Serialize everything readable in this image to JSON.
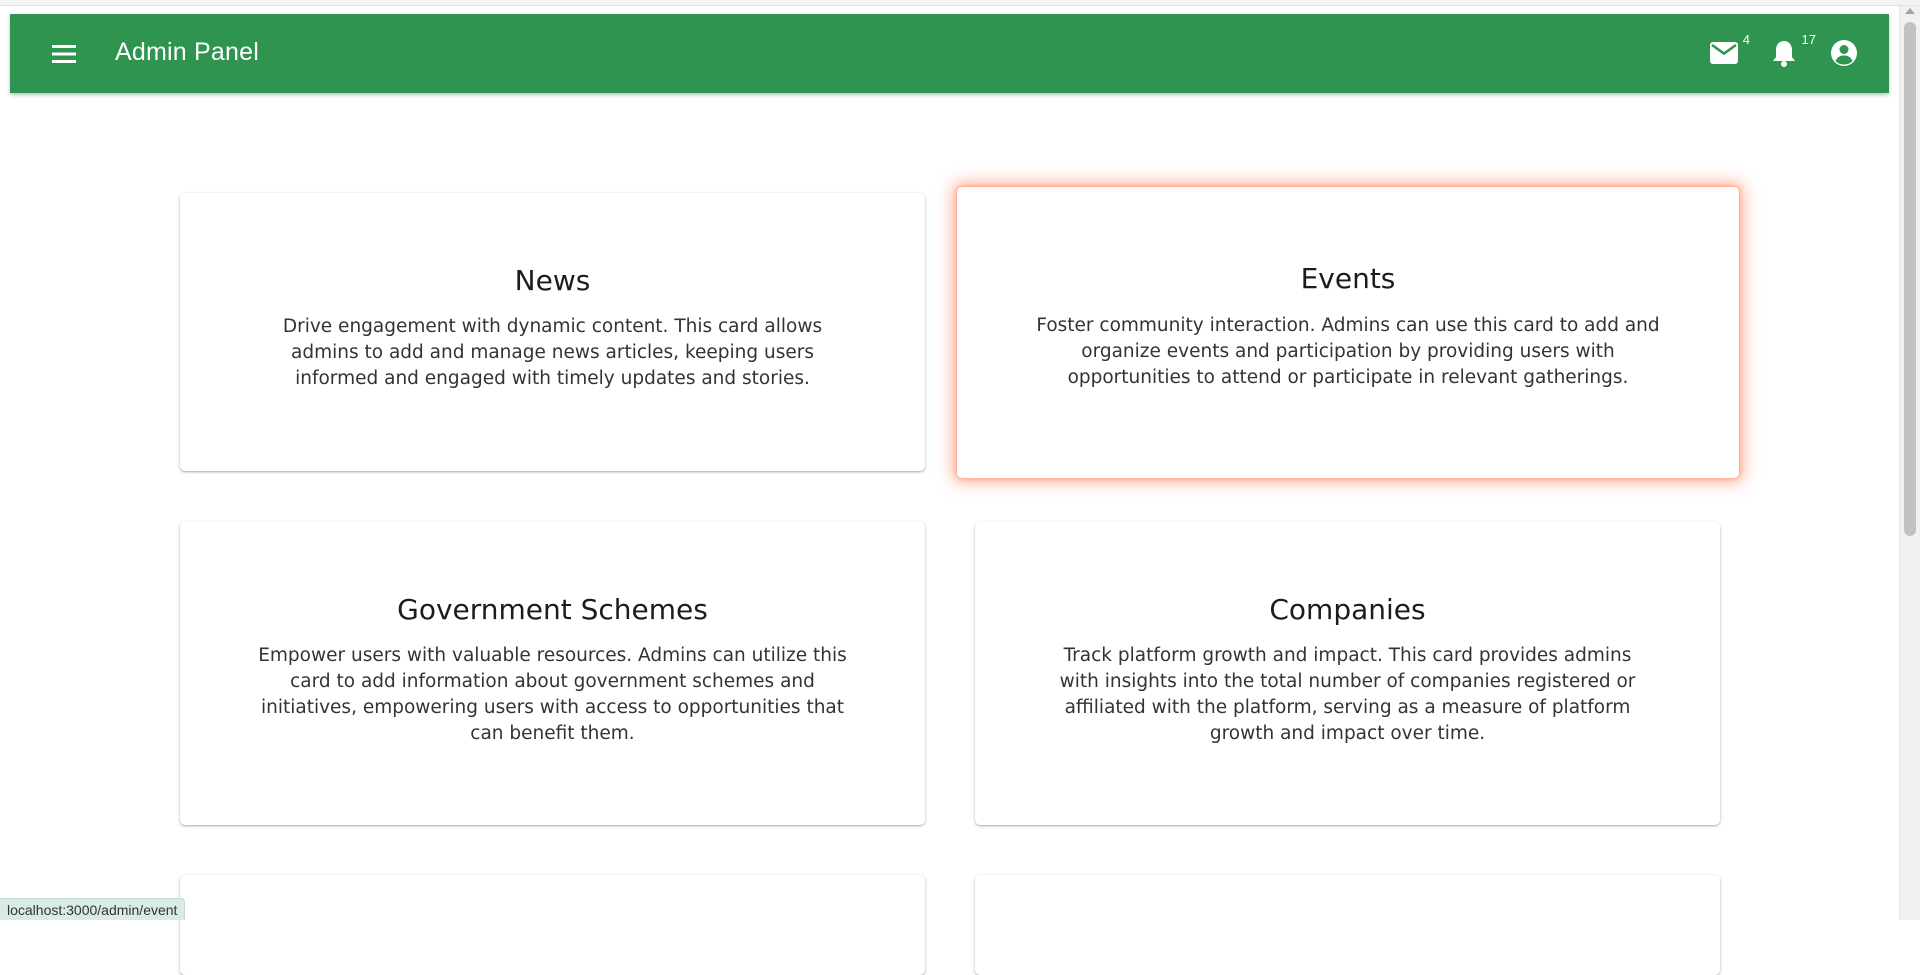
{
  "appbar": {
    "title": "Admin Panel",
    "color": "#2e9450",
    "menu_icon": "hamburger-menu-icon",
    "actions": [
      {
        "icon": "mail-icon",
        "badge": "4"
      },
      {
        "icon": "bell-icon",
        "badge": "17"
      },
      {
        "icon": "account-circle-icon",
        "badge": ""
      }
    ]
  },
  "cards": [
    {
      "title": "News",
      "description": "Drive engagement with dynamic content. This card allows admins to add and manage news articles, keeping users informed and engaged with timely updates and stories."
    },
    {
      "title": "Events",
      "description": "Foster community interaction. Admins can use this card to add and organize events and participation by providing users with opportunities to attend or participate in relevant gatherings.",
      "hovered": true
    },
    {
      "title": "Government Schemes",
      "description": "Empower users with valuable resources. Admins can utilize this card to add information about government schemes and initiatives, empowering users with access to opportunities that can benefit them."
    },
    {
      "title": "Companies",
      "description": "Track platform growth and impact. This card provides admins with insights into the total number of companies registered or affiliated with the platform, serving as a measure of platform growth and impact over time."
    }
  ],
  "status_bar": {
    "url": "localhost:3000/admin/event"
  },
  "colors": {
    "hover_glow": "#ff6e3c"
  }
}
